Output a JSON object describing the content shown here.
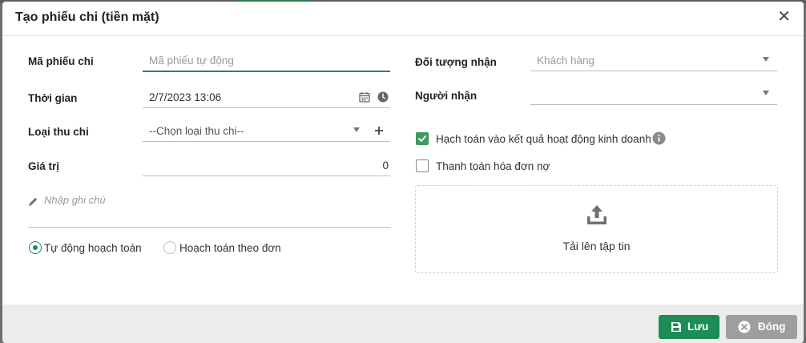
{
  "dialog": {
    "title": "Tạo phiếu chi (tiền mặt)",
    "close_glyph": "✕"
  },
  "form": {
    "receipt_code": {
      "label": "Mã phiếu chi",
      "placeholder": "Mã phiếu tự động"
    },
    "time": {
      "label": "Thời gian",
      "value": "2/7/2023 13:06"
    },
    "expense_type": {
      "label": "Loại thu chi",
      "placeholder": "--Chọn loại thu chi--"
    },
    "amount": {
      "label": "Giá trị",
      "value": "0"
    },
    "note": {
      "placeholder": "Nhập ghi chú"
    },
    "accounting_mode": {
      "options": [
        "Tự động hoạch toán",
        "Hoạch toán theo đơn"
      ],
      "selected": "Tự động hoạch toán"
    },
    "recipient_type": {
      "label": "Đối tượng nhận",
      "placeholder": "Khách hàng"
    },
    "recipient": {
      "label": "Người nhận",
      "value": ""
    },
    "include_in_business_results": {
      "label": "Hạch toán vào kết quả hoạt động kinh doanh",
      "checked": true
    },
    "pay_debt_invoices": {
      "label": "Thanh toán hóa đơn nợ",
      "checked": false
    },
    "upload": {
      "label": "Tải lên tập tin"
    }
  },
  "footer": {
    "save_label": "Lưu",
    "close_label": "Đóng"
  },
  "colors": {
    "primary": "#1e8c57",
    "save_button": "#1e8c57",
    "close_button": "#9e9e9e",
    "checkbox_checked": "#3f9a5c"
  }
}
